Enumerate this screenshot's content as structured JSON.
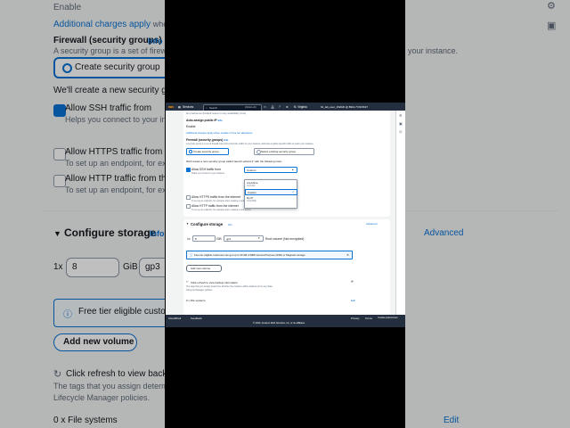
{
  "bg": {
    "enable": "Enable",
    "additional_charges": "Additional charges apply",
    "additional_charges_tail": "when ou",
    "firewall_title": "Firewall (security groups)",
    "info": "Info",
    "firewall_desc": "A security group is a set of firewall rules",
    "firewall_tail": "your instance.",
    "create_sg": "Create security group",
    "we_create": "We'll create a new security group",
    "allow_ssh": "Allow SSH traffic from",
    "ssh_desc": "Helps you connect to your instance",
    "allow_https": "Allow HTTPS traffic from the",
    "https_desc": "To set up an endpoint, for example",
    "allow_http": "Allow HTTP traffic from the in",
    "http_desc": "To set up an endpoint, for example",
    "configure_storage": "Configure storage",
    "advanced": "Advanced",
    "qty": "1x",
    "size": "8",
    "gib": "GiB",
    "vol_type": "gp3",
    "free_tier": "Free tier eligible custome",
    "add_volume": "Add new volume",
    "click_refresh": "Click refresh to view backup",
    "tags_desc": "The tags that you assign determi",
    "lifecycle": "Lifecycle Manager policies.",
    "file_systems": "0 x File systems",
    "edit": "Edit"
  },
  "nav": {
    "aws": "aws",
    "services": "Services",
    "search_placeholder": "Search",
    "shortcut": "[Option+S]",
    "region": "N. Virginia",
    "account": "hh_lab_user_152620 @ 8913-7729-5627"
  },
  "form": {
    "preference": "No preference (Default subnet in any availability zone)",
    "auto_assign": "Auto-assign public IP",
    "info": "Info",
    "enable": "Enable",
    "additional_charges": "Additional charges apply when outside of free tier allowance",
    "firewall_title": "Firewall (security groups)",
    "firewall_desc": "A security group is a set of firewall rules that control the traffic for your instance. Add rules to allow specific traffic to reach your instance.",
    "create_sg": "Create security group",
    "select_sg": "Select existing security group",
    "we_create": "We'll create a new security group called 'launch-wizard-1' with the following rules:",
    "allow_ssh": "Allow SSH traffic from",
    "ssh_desc": "Helps you connect to your instance",
    "ssh_value": "Custom",
    "allow_https": "Allow HTTPS traffic from the internet",
    "https_desc": "To set up an endpoint, for example when creating a web server",
    "allow_http": "Allow HTTP traffic from the internet",
    "http_desc": "To set up an endpoint, for example when creating a web server",
    "dropdown": [
      "Anywhere",
      "0.0.0.0/0",
      "Custom",
      "My IP",
      "0.0.0.0/32"
    ]
  },
  "storage": {
    "title": "Configure storage",
    "info": "Info",
    "advanced": "Advanced",
    "qty": "1x",
    "size": "8",
    "gib": "GiB",
    "vol_type": "gp3",
    "root_volume": "Root volume  (Not encrypted)",
    "free_tier": "Free tier eligible customers can get up to 30 GB of EBS General Purpose (SSD) or Magnetic storage",
    "add_volume": "Add new volume",
    "click_refresh": "Click refresh to view backup information",
    "tags_desc": "The tags that you assign determine whether the instance will be backed up by any Data",
    "lifecycle": "Lifecycle Manager policies.",
    "file_systems": "0 x File systems",
    "edit": "Edit"
  },
  "footer": {
    "cloudshell": "CloudShell",
    "feedback": "Feedback",
    "privacy": "Privacy",
    "terms": "Terms",
    "cookies": "Cookie preferences",
    "copyright": "© 2024, Amazon Web Services, Inc. or its affiliates."
  }
}
